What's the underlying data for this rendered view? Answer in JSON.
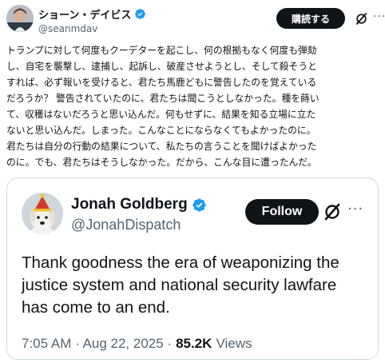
{
  "post": {
    "author_name": "ショーン・デイビス",
    "author_handle": "@seanmdav",
    "subscribe_label": "購読する",
    "more_label": "···",
    "text_lines": [
      "トランプに対して何度もクーデターを起こし、何の根拠もなく何度も弾劾",
      "し、自宅を襲撃し、逮捕し、起訴し、破産させようとし、そして殺そうと",
      "すれば、必ず報いを受けると、君たち馬鹿どもに警告したのを覚えている",
      "だろうか？ 警告されていたのに、君たちは聞こうとしなかった。種を蒔い",
      "て、収穫はないだろうと思い込んだ。何もせずに、結果を知る立場に立た",
      "ないと思い込んだ。しまった。こんなことにならなくてもよかったのに。",
      "君たちは自分の行動の結果について、私たちの言うことを聞けばよかった",
      "のに。でも、君たちはそうしなかった。だから、こんな目に遭ったんだ。"
    ]
  },
  "quote": {
    "author_name": "Jonah Goldberg",
    "author_handle": "@JonahDispatch",
    "follow_label": "Follow",
    "more_label": "···",
    "text_lines": [
      "Thank goodness the era of weaponizing the",
      "justice system and national security lawfare",
      "has come to an end."
    ],
    "timestamp": "7:05 AM · Aug 22, 2025 ·",
    "views_count": "85.2K",
    "views_label": "Views"
  },
  "colors": {
    "text_primary": "#0f1419",
    "text_secondary": "#536471",
    "verified_blue": "#1d9bf0",
    "button_dark": "#0f1419",
    "border": "#cfd9de"
  },
  "icons": {
    "verified": "verified-badge-icon",
    "grok": "grok-icon",
    "more": "more-horizontal-icon"
  }
}
